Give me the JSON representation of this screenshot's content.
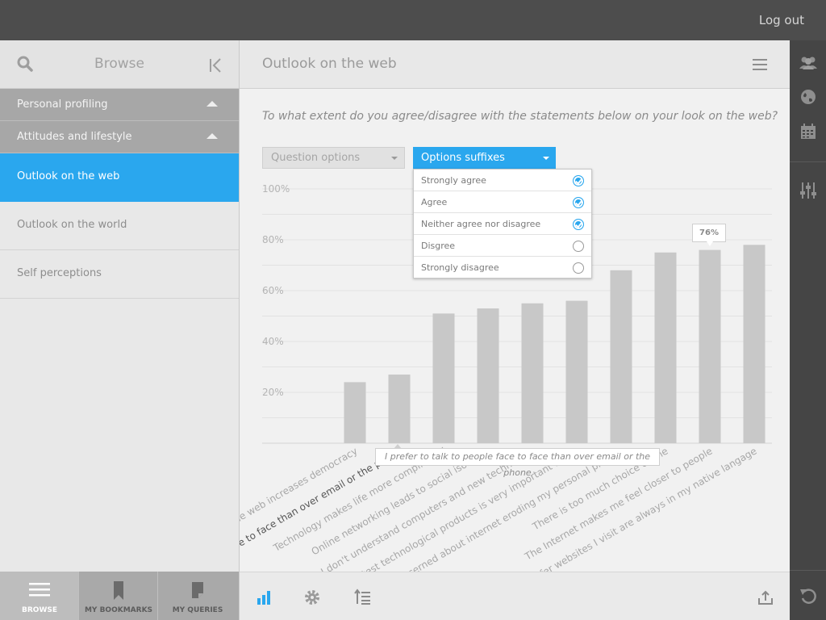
{
  "topbar": {
    "logout_label": "Log out"
  },
  "sidebar": {
    "title": "Browse",
    "sections": [
      {
        "label": "Personal profiling"
      },
      {
        "label": "Attitudes and lifestyle"
      }
    ],
    "items": [
      {
        "label": "Outlook on the web",
        "active": true
      },
      {
        "label": "Outlook on the world",
        "active": false
      },
      {
        "label": "Self perceptions",
        "active": false
      }
    ],
    "tabs": [
      {
        "label": "BROWSE",
        "icon": "list-icon",
        "active": true
      },
      {
        "label": "MY BOOKMARKS",
        "icon": "bookmark-icon",
        "active": false
      },
      {
        "label": "MY QUERIES",
        "icon": "document-icon",
        "active": false
      }
    ]
  },
  "main": {
    "title": "Outlook on the web",
    "question": "To what extent do you agree/disagree with the statements below on your look on the web?",
    "question_options_label": "Question options",
    "options_suffixes_label": "Options suffixes",
    "options": [
      {
        "label": "Strongly agree",
        "checked": true
      },
      {
        "label": "Agree",
        "checked": true
      },
      {
        "label": "Neither agree nor disagree",
        "checked": true
      },
      {
        "label": "Disgree",
        "checked": false
      },
      {
        "label": "Strongly disagree",
        "checked": false
      }
    ],
    "hover_tooltip": "I prefer to talk to people face to face than over email or the phone",
    "value_tooltip": "76%"
  },
  "colors": {
    "accent": "#2aa7ee",
    "bar": "#c8c8c8",
    "topbar": "#4d4d4d",
    "rail": "#454545"
  },
  "chart_data": {
    "type": "bar",
    "categories": [
      "The web increases democracy",
      "I prefer to talk to people face to face than over email or the phone",
      "Technology makes life more complicated",
      "Online networking leads to social isolation",
      "I don't understand computers and new technology",
      "Having the latest technological products is very important to me",
      "I am concerned about internet eroding my personal privacy",
      "There is too much choice online",
      "The Internet makes me feel closer to people",
      "I prefer websites I visit are always in my native langage"
    ],
    "values": [
      24,
      27,
      51,
      53,
      55,
      56,
      68,
      75,
      76,
      78
    ],
    "highlighted_index": 1,
    "yticks": [
      "100%",
      "80%",
      "60%",
      "40%",
      "20%"
    ],
    "ylim": [
      0,
      100
    ],
    "grid": true
  }
}
